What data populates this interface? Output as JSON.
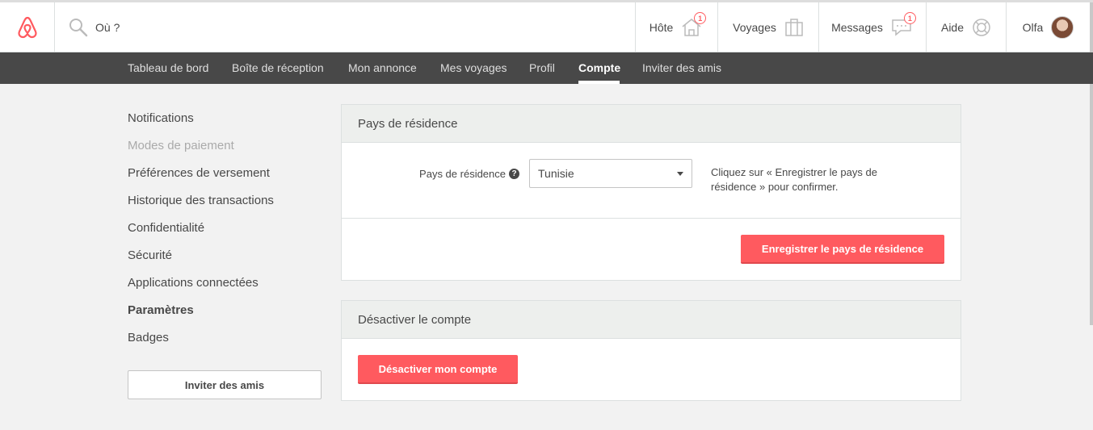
{
  "header": {
    "search_placeholder": "Où ?",
    "nav": {
      "host": "Hôte",
      "host_badge": "1",
      "trips": "Voyages",
      "messages": "Messages",
      "messages_badge": "1",
      "help": "Aide",
      "user": "Olfa"
    }
  },
  "subnav": {
    "items": [
      "Tableau de bord",
      "Boîte de réception",
      "Mon annonce",
      "Mes voyages",
      "Profil",
      "Compte",
      "Inviter des amis"
    ],
    "active": "Compte"
  },
  "sidebar": {
    "items": [
      "Notifications",
      "Modes de paiement",
      "Préférences de versement",
      "Historique des transactions",
      "Confidentialité",
      "Sécurité",
      "Applications connectées",
      "Paramètres",
      "Badges"
    ],
    "active": "Paramètres",
    "invite_button": "Inviter des amis"
  },
  "residence_panel": {
    "title": "Pays de résidence",
    "field_label": "Pays de résidence",
    "help_glyph": "?",
    "selected_country": "Tunisie",
    "hint": "Cliquez sur « Enregistrer le pays de résidence » pour confirmer.",
    "save_button": "Enregistrer le pays de résidence"
  },
  "deactivate_panel": {
    "title": "Désactiver le compte",
    "button": "Désactiver mon compte"
  },
  "colors": {
    "brand": "#ff5a5f",
    "subnav_bg": "#484848",
    "page_bg": "#f2f2f2"
  }
}
